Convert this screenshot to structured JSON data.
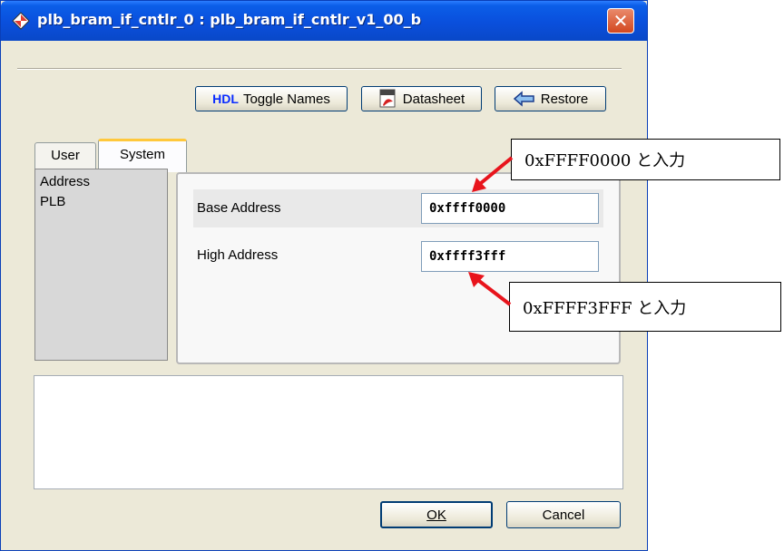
{
  "window": {
    "title": "plb_bram_if_cntlr_0 : plb_bram_if_cntlr_v1_00_b",
    "close_label": "✕"
  },
  "toolbar": {
    "hdl_tag": "HDL",
    "toggle_names_label": "Toggle Names",
    "datasheet_label": "Datasheet",
    "restore_label": "Restore"
  },
  "tabs": [
    {
      "label": "User",
      "active": false
    },
    {
      "label": "System",
      "active": true
    }
  ],
  "sidebar": {
    "items": [
      {
        "label": "Address",
        "selected": true
      },
      {
        "label": "PLB",
        "selected": false
      }
    ]
  },
  "fields": {
    "base_address": {
      "label": "Base Address",
      "value": "0xffff0000"
    },
    "high_address": {
      "label": "High Address",
      "value": "0xffff3fff"
    }
  },
  "dialog_buttons": {
    "ok_label": "OK",
    "cancel_label": "Cancel"
  },
  "annotations": [
    {
      "text": "0xFFFF0000 と入力"
    },
    {
      "text": "0xFFFF3FFF と入力"
    }
  ],
  "colors": {
    "title_bar": "#0a4fdc",
    "close_button": "#d3471f",
    "active_tab_highlight": "#ffc83c",
    "arrow": "#e8141c",
    "window_bg": "#ece9d8"
  }
}
